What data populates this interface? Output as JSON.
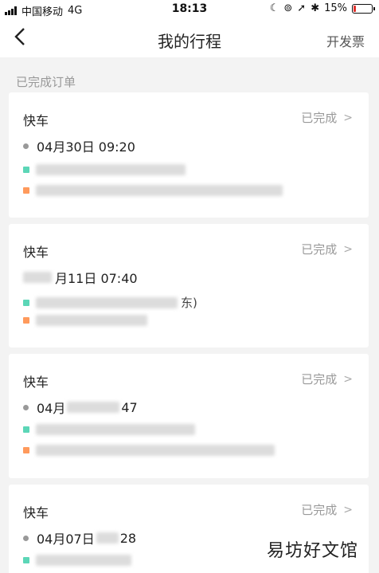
{
  "status_bar": {
    "carrier": "中国移动",
    "network": "4G",
    "time": "18:13",
    "battery": "15%",
    "battery_level": 0.15
  },
  "nav": {
    "title": "我的行程",
    "invoice_label": "开发票"
  },
  "section_label": "已完成订单",
  "trips": [
    {
      "type": "快车",
      "status": "已完成",
      "time": "04月30日 09:20"
    },
    {
      "type": "快车",
      "status": "已完成",
      "time": "月11日 07:40",
      "addr_fragment": "东)"
    },
    {
      "type": "快车",
      "status": "已完成",
      "time_prefix": "04月",
      "time_suffix": "47"
    },
    {
      "type": "快车",
      "status": "已完成",
      "time_prefix": "04月07日",
      "time_suffix": "28"
    }
  ],
  "watermark": "易坊好文馆",
  "colors": {
    "start_marker": "#5cd6b7",
    "end_marker": "#ff9a5c",
    "status_gray": "#999999"
  }
}
